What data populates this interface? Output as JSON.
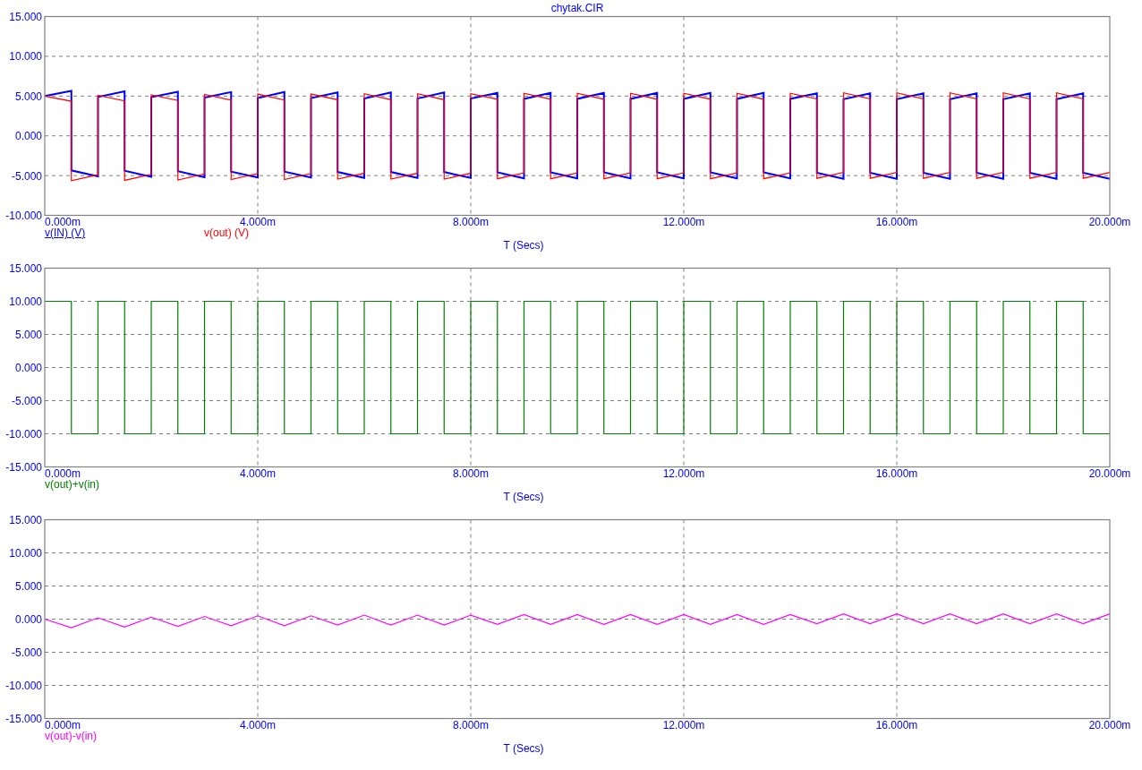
{
  "panels": [
    {
      "legend_underline": [
        true,
        false
      ],
      "chart_data": {
        "type": "line",
        "title": "chytak.CIR",
        "xlabel": "T (Secs)",
        "ylim": [
          -10,
          15
        ],
        "xlim": [
          0,
          20
        ],
        "yticks": [
          {
            "value": 15,
            "label": "15.000"
          },
          {
            "value": 10,
            "label": "10.000"
          },
          {
            "value": 5,
            "label": "5.000"
          },
          {
            "value": 0,
            "label": "0.000"
          },
          {
            "value": -5,
            "label": "-5.000"
          },
          {
            "value": -10,
            "label": "-10.000"
          }
        ],
        "xticks": [
          {
            "value": 0,
            "label": "0.000m"
          },
          {
            "value": 4,
            "label": "4.000m"
          },
          {
            "value": 8,
            "label": "8.000m"
          },
          {
            "value": 12,
            "label": "12.000m"
          },
          {
            "value": 16,
            "label": "16.000m"
          },
          {
            "value": 20,
            "label": "20.000m"
          }
        ],
        "x": [
          0,
          0.5,
          0.5,
          1,
          1,
          1.5,
          1.5,
          2,
          2,
          2.5,
          2.5,
          3,
          3,
          3.5,
          3.5,
          4,
          4,
          4.5,
          4.5,
          5,
          5,
          5.5,
          5.5,
          6,
          6,
          6.5,
          6.5,
          7,
          7,
          7.5,
          7.5,
          8,
          8,
          8.5,
          8.5,
          9,
          9,
          9.5,
          9.5,
          10,
          10,
          10.5,
          10.5,
          11,
          11,
          11.5,
          11.5,
          12,
          12,
          12.5,
          12.5,
          13,
          13,
          13.5,
          13.5,
          14,
          14,
          14.5,
          14.5,
          15,
          15,
          15.5,
          15.5,
          16,
          16,
          16.5,
          16.5,
          17,
          17,
          17.5,
          17.5,
          18,
          18,
          18.5,
          18.5,
          19,
          19,
          19.5,
          19.5,
          20
        ],
        "grid": true,
        "series": [
          {
            "name": "v(IN) (V)",
            "color": "#0000ff",
            "values": [
              5,
              5.65,
              -4.35,
              -5.1,
              4.9,
              5.6,
              -4.4,
              -5.15,
              4.85,
              5.55,
              -4.45,
              -5.2,
              4.8,
              5.5,
              -4.5,
              -5.25,
              4.75,
              5.5,
              -4.5,
              -5.25,
              4.75,
              5.45,
              -4.55,
              -5.3,
              4.7,
              5.45,
              -4.55,
              -5.3,
              4.7,
              5.45,
              -4.55,
              -5.3,
              4.7,
              5.4,
              -4.6,
              -5.35,
              4.65,
              5.4,
              -4.6,
              -5.35,
              4.65,
              5.4,
              -4.6,
              -5.35,
              4.65,
              5.4,
              -4.6,
              -5.35,
              4.65,
              5.4,
              -4.6,
              -5.35,
              4.65,
              5.4,
              -4.6,
              -5.35,
              4.65,
              5.35,
              -4.65,
              -5.4,
              4.6,
              5.35,
              -4.65,
              -5.4,
              4.6,
              5.35,
              -4.65,
              -5.4,
              4.6,
              5.35,
              -4.65,
              -5.4,
              4.6,
              5.35,
              -4.65,
              -5.4,
              4.6,
              5.35,
              -4.65,
              -5.4
            ]
          },
          {
            "name": "v(out) (V)",
            "color": "#ff0000",
            "values": [
              5,
              4.35,
              -5.65,
              -4.9,
              5.1,
              4.4,
              -5.6,
              -4.85,
              5.15,
              4.45,
              -5.55,
              -4.8,
              5.2,
              4.5,
              -5.5,
              -4.75,
              5.25,
              4.5,
              -5.5,
              -4.75,
              5.25,
              4.55,
              -5.45,
              -4.7,
              5.3,
              4.55,
              -5.45,
              -4.7,
              5.3,
              4.55,
              -5.45,
              -4.7,
              5.3,
              4.6,
              -5.4,
              -4.65,
              5.35,
              4.6,
              -5.4,
              -4.65,
              5.35,
              4.6,
              -5.4,
              -4.65,
              5.35,
              4.6,
              -5.4,
              -4.65,
              5.35,
              4.6,
              -5.4,
              -4.65,
              5.35,
              4.6,
              -5.4,
              -4.65,
              5.35,
              4.65,
              -5.35,
              -4.6,
              5.4,
              4.65,
              -5.35,
              -4.6,
              5.4,
              4.65,
              -5.35,
              -4.6,
              5.4,
              4.65,
              -5.35,
              -4.6,
              5.4,
              4.65,
              -5.35,
              -4.6,
              5.4,
              4.65,
              -5.35,
              -4.6
            ]
          }
        ]
      }
    },
    {
      "legend_underline": [
        false
      ],
      "chart_data": {
        "type": "line",
        "xlabel": "T (Secs)",
        "ylim": [
          -15,
          15
        ],
        "xlim": [
          0,
          20
        ],
        "yticks": [
          {
            "value": 15,
            "label": "15.000"
          },
          {
            "value": 10,
            "label": "10.000"
          },
          {
            "value": 5,
            "label": "5.000"
          },
          {
            "value": 0,
            "label": "0.000"
          },
          {
            "value": -5,
            "label": "-5.000"
          },
          {
            "value": -10,
            "label": "-10.000"
          },
          {
            "value": -15,
            "label": "-15.000"
          }
        ],
        "xticks": [
          {
            "value": 0,
            "label": "0.000m"
          },
          {
            "value": 4,
            "label": "4.000m"
          },
          {
            "value": 8,
            "label": "8.000m"
          },
          {
            "value": 12,
            "label": "12.000m"
          },
          {
            "value": 16,
            "label": "16.000m"
          },
          {
            "value": 20,
            "label": "20.000m"
          }
        ],
        "x": [
          0,
          0.5,
          0.5,
          1,
          1,
          1.5,
          1.5,
          2,
          2,
          2.5,
          2.5,
          3,
          3,
          3.5,
          3.5,
          4,
          4,
          4.5,
          4.5,
          5,
          5,
          5.5,
          5.5,
          6,
          6,
          6.5,
          6.5,
          7,
          7,
          7.5,
          7.5,
          8,
          8,
          8.5,
          8.5,
          9,
          9,
          9.5,
          9.5,
          10,
          10,
          10.5,
          10.5,
          11,
          11,
          11.5,
          11.5,
          12,
          12,
          12.5,
          12.5,
          13,
          13,
          13.5,
          13.5,
          14,
          14,
          14.5,
          14.5,
          15,
          15,
          15.5,
          15.5,
          16,
          16,
          16.5,
          16.5,
          17,
          17,
          17.5,
          17.5,
          18,
          18,
          18.5,
          18.5,
          19,
          19,
          19.5,
          19.5,
          20
        ],
        "grid": true,
        "series": [
          {
            "name": "v(out)+v(in)",
            "color": "#008000",
            "values": [
              10,
              10,
              -10,
              -10,
              10,
              10,
              -10,
              -10,
              10,
              10,
              -10,
              -10,
              10,
              10,
              -10,
              -10,
              10,
              10,
              -10,
              -10,
              10,
              10,
              -10,
              -10,
              10,
              10,
              -10,
              -10,
              10,
              10,
              -10,
              -10,
              10,
              10,
              -10,
              -10,
              10,
              10,
              -10,
              -10,
              10,
              10,
              -10,
              -10,
              10,
              10,
              -10,
              -10,
              10,
              10,
              -10,
              -10,
              10,
              10,
              -10,
              -10,
              10,
              10,
              -10,
              -10,
              10,
              10,
              -10,
              -10,
              10,
              10,
              -10,
              -10,
              10,
              10,
              -10,
              -10,
              10,
              10,
              -10,
              -10,
              10,
              10,
              -10,
              -10
            ]
          }
        ]
      }
    },
    {
      "legend_underline": [
        false
      ],
      "chart_data": {
        "type": "line",
        "xlabel": "T (Secs)",
        "ylim": [
          -15,
          15
        ],
        "xlim": [
          0,
          20
        ],
        "yticks": [
          {
            "value": 15,
            "label": "15.000"
          },
          {
            "value": 10,
            "label": "10.000"
          },
          {
            "value": 5,
            "label": "5.000"
          },
          {
            "value": 0,
            "label": "0.000"
          },
          {
            "value": -5,
            "label": "-5.000"
          },
          {
            "value": -10,
            "label": "-10.000"
          },
          {
            "value": -15,
            "label": "-15.000"
          }
        ],
        "xticks": [
          {
            "value": 0,
            "label": "0.000m"
          },
          {
            "value": 4,
            "label": "4.000m"
          },
          {
            "value": 8,
            "label": "8.000m"
          },
          {
            "value": 12,
            "label": "12.000m"
          },
          {
            "value": 16,
            "label": "16.000m"
          },
          {
            "value": 20,
            "label": "20.000m"
          }
        ],
        "x": [
          0,
          0.5,
          1,
          1.5,
          2,
          2.5,
          3,
          3.5,
          4,
          4.5,
          5,
          5.5,
          6,
          6.5,
          7,
          7.5,
          8,
          8.5,
          9,
          9.5,
          10,
          10.5,
          11,
          11.5,
          12,
          12.5,
          13,
          13.5,
          14,
          14.5,
          15,
          15.5,
          16,
          16.5,
          17,
          17.5,
          18,
          18.5,
          19,
          19.5,
          20
        ],
        "grid": true,
        "series": [
          {
            "name": "v(out)-v(in)",
            "color": "#ff00ff",
            "values": [
              0,
              -1.3,
              0.2,
              -1.2,
              0.3,
              -1.1,
              0.4,
              -1.0,
              0.5,
              -1.0,
              0.5,
              -0.9,
              0.6,
              -0.9,
              0.6,
              -0.9,
              0.6,
              -0.8,
              0.7,
              -0.8,
              0.7,
              -0.8,
              0.7,
              -0.8,
              0.7,
              -0.8,
              0.7,
              -0.8,
              0.7,
              -0.7,
              0.8,
              -0.7,
              0.8,
              -0.7,
              0.8,
              -0.7,
              0.8,
              -0.7,
              0.8,
              -0.7,
              0.8
            ]
          }
        ]
      }
    }
  ]
}
